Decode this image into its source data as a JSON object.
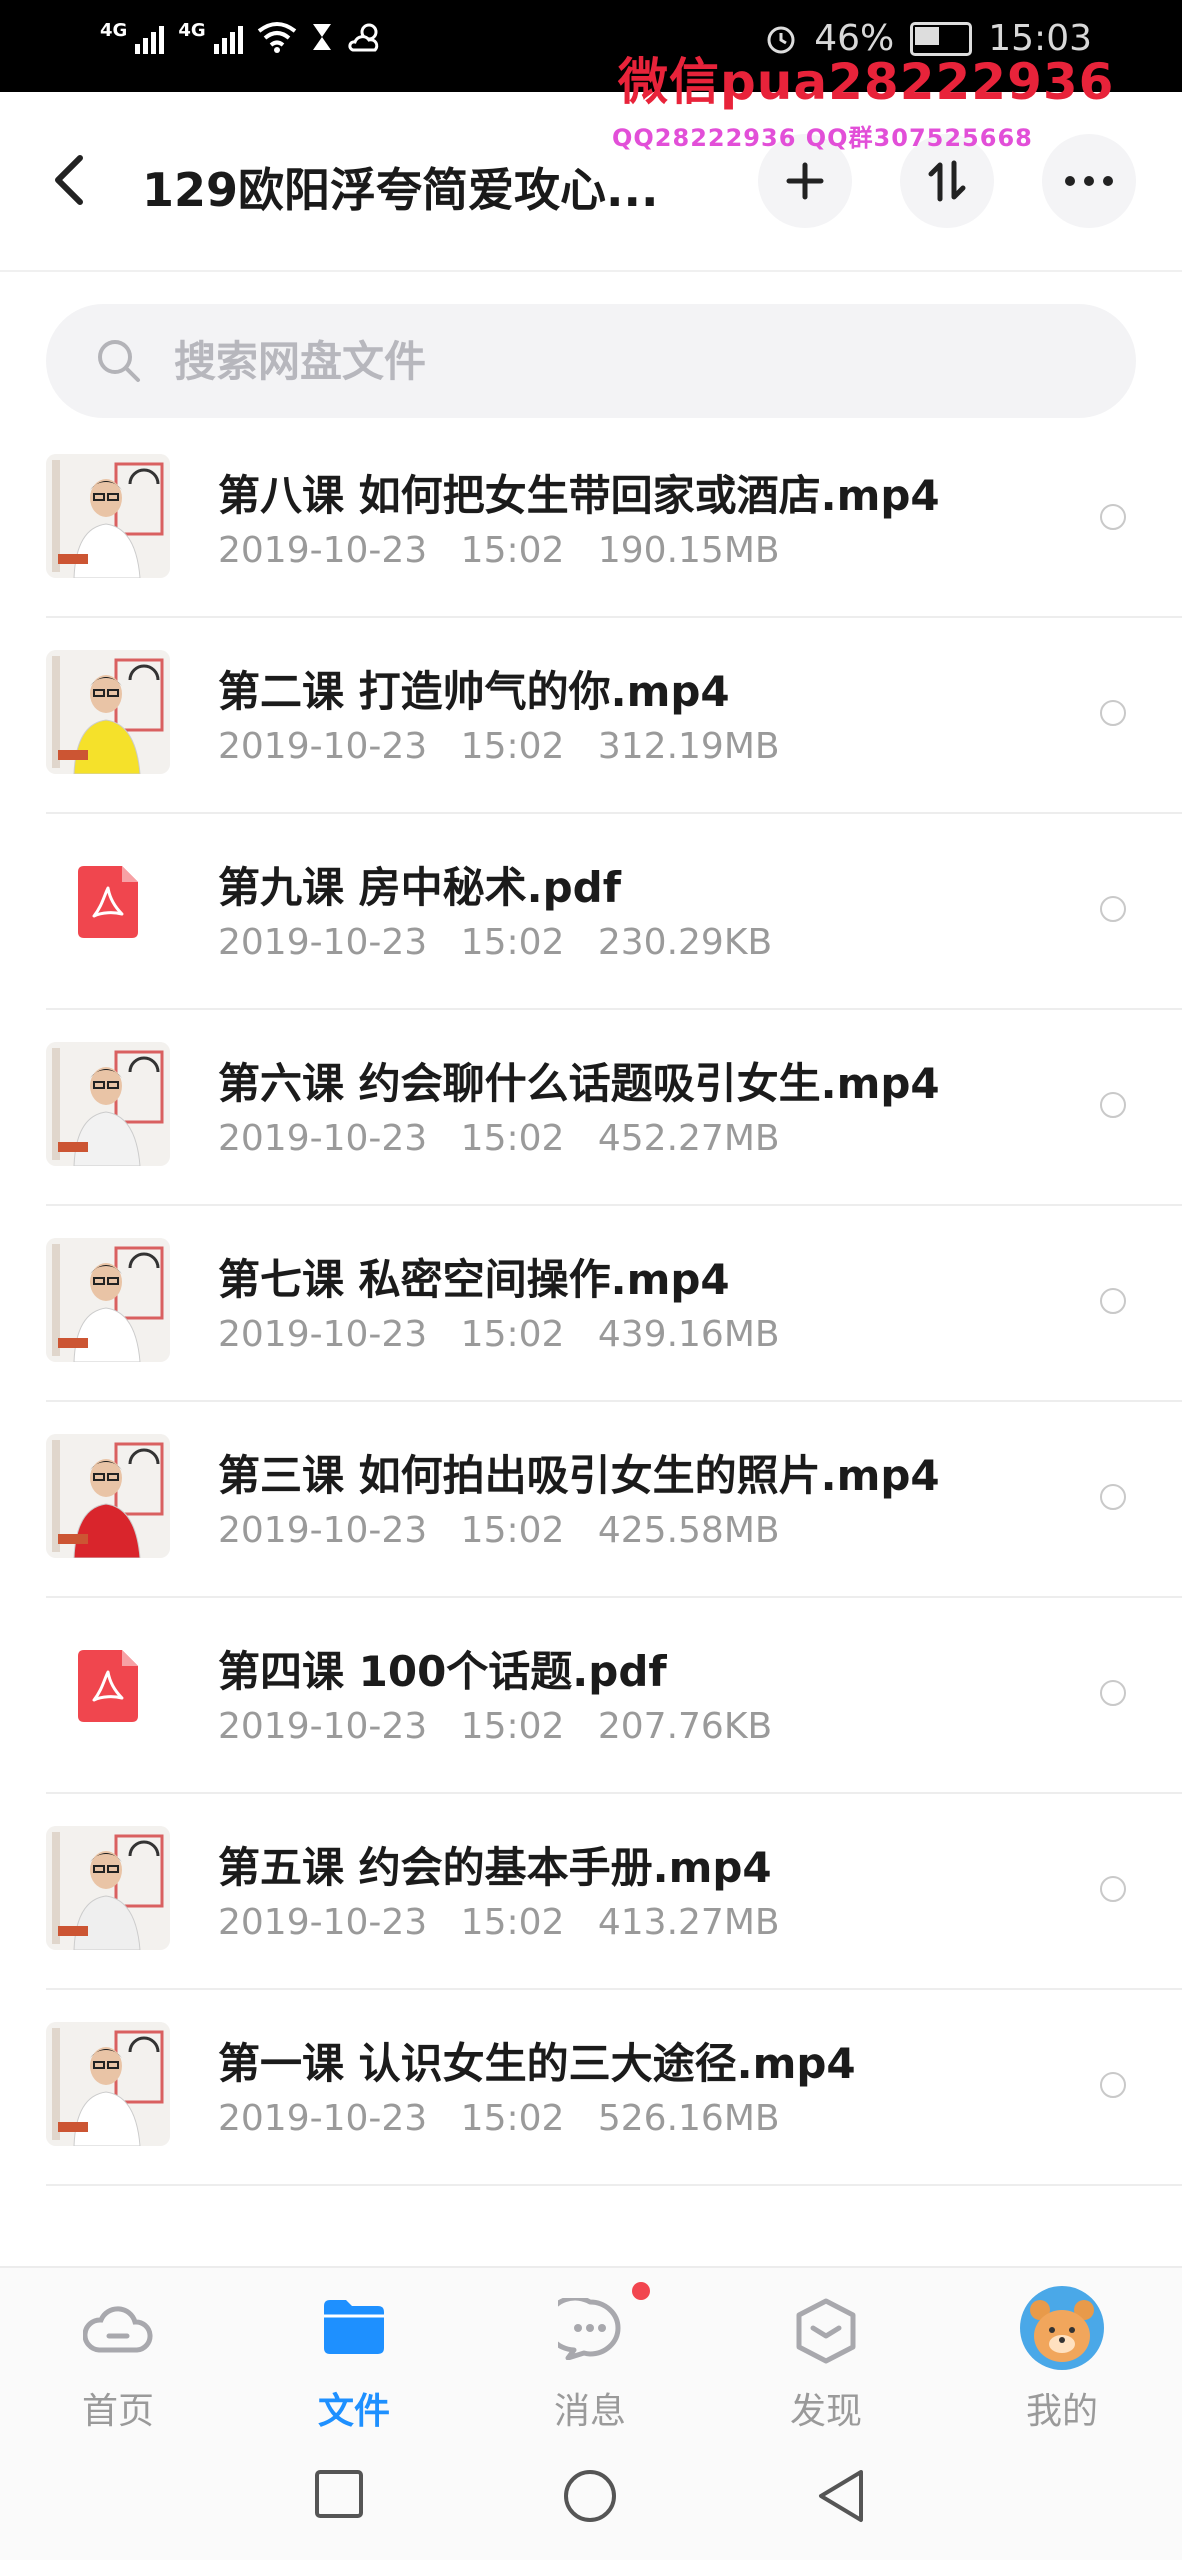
{
  "status_bar": {
    "network1": "4G",
    "network2": "4G",
    "battery": "46%",
    "time": "15:03"
  },
  "watermark": {
    "line1": "微信pua28222936",
    "line2": "QQ28222936 QQ群307525668"
  },
  "header": {
    "title": "129欧阳浮夸简爱攻心...",
    "icons": [
      "back-icon",
      "add-icon",
      "sort-icon",
      "more-icon"
    ]
  },
  "search": {
    "placeholder": "搜索网盘文件",
    "value": ""
  },
  "files": [
    {
      "name": "第八课 如何把女生带回家或酒店.mp4",
      "date": "2019-10-23",
      "time": "15:02",
      "size": "190.15MB",
      "type": "video",
      "shirt": "#ffffff"
    },
    {
      "name": "第二课 打造帅气的你.mp4",
      "date": "2019-10-23",
      "time": "15:02",
      "size": "312.19MB",
      "type": "video",
      "shirt": "#f5e12a"
    },
    {
      "name": "第九课 房中秘术.pdf",
      "date": "2019-10-23",
      "time": "15:02",
      "size": "230.29KB",
      "type": "pdf"
    },
    {
      "name": "第六课 约会聊什么话题吸引女生.mp4",
      "date": "2019-10-23",
      "time": "15:02",
      "size": "452.27MB",
      "type": "video",
      "shirt": "#f2f2f2"
    },
    {
      "name": "第七课 私密空间操作.mp4",
      "date": "2019-10-23",
      "time": "15:02",
      "size": "439.16MB",
      "type": "video",
      "shirt": "#ffffff"
    },
    {
      "name": "第三课 如何拍出吸引女生的照片.mp4",
      "date": "2019-10-23",
      "time": "15:02",
      "size": "425.58MB",
      "type": "video",
      "shirt": "#d9252c"
    },
    {
      "name": "第四课 100个话题.pdf",
      "date": "2019-10-23",
      "time": "15:02",
      "size": "207.76KB",
      "type": "pdf"
    },
    {
      "name": "第五课 约会的基本手册.mp4",
      "date": "2019-10-23",
      "time": "15:02",
      "size": "413.27MB",
      "type": "video",
      "shirt": "#efefef"
    },
    {
      "name": "第一课 认识女生的三大途径.mp4",
      "date": "2019-10-23",
      "time": "15:02",
      "size": "526.16MB",
      "type": "video",
      "shirt": "#ffffff"
    }
  ],
  "tabs": [
    {
      "label": "首页",
      "icon": "cloud-icon",
      "active": false
    },
    {
      "label": "文件",
      "icon": "folder-icon",
      "active": true
    },
    {
      "label": "消息",
      "icon": "chat-icon",
      "active": false,
      "badge": true
    },
    {
      "label": "发现",
      "icon": "discover-icon",
      "active": false
    },
    {
      "label": "我的",
      "icon": "avatar-icon",
      "active": false
    }
  ],
  "colors": {
    "accent": "#1e90ff",
    "pdf": "#f0464e",
    "watermark_red": "#e8233a",
    "watermark_pink": "#e24fd8",
    "badge": "#f2454f"
  }
}
